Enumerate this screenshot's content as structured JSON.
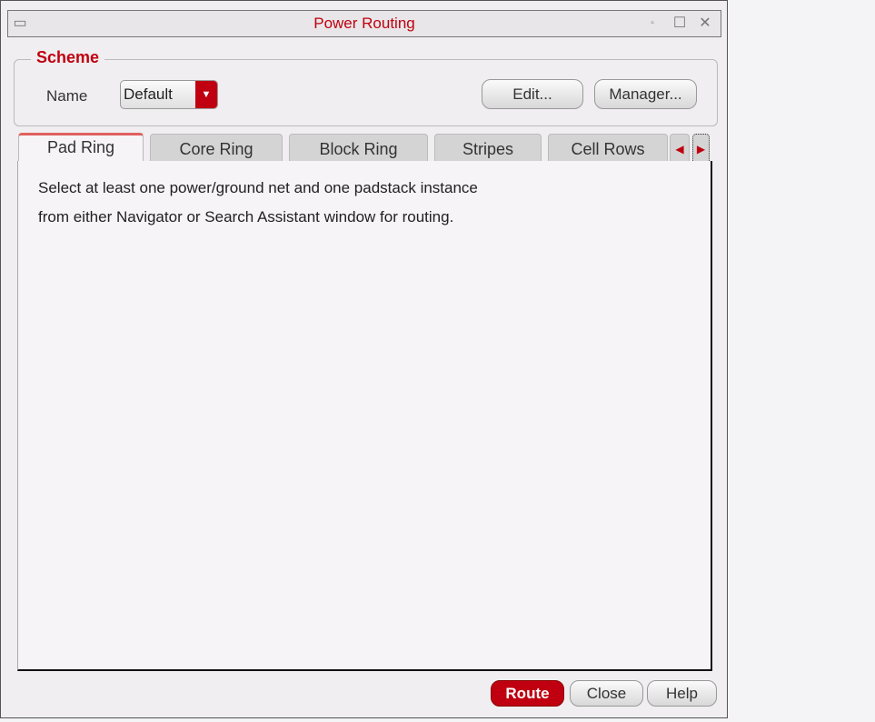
{
  "window": {
    "title": "Power Routing"
  },
  "scheme": {
    "legend": "Scheme",
    "name_label": "Name",
    "name_value": "Default",
    "edit_label": "Edit...",
    "manager_label": "Manager..."
  },
  "tabs": [
    "Pad Ring",
    "Core Ring",
    "Block Ring",
    "Stripes",
    "Cell Rows"
  ],
  "panel": {
    "line1": "Select at least one power/ground net and one padstack instance",
    "line2": "from either Navigator or Search Assistant window for routing."
  },
  "footer": {
    "route": "Route",
    "close": "Close",
    "help": "Help"
  },
  "colors": {
    "accent": "#c00010"
  }
}
